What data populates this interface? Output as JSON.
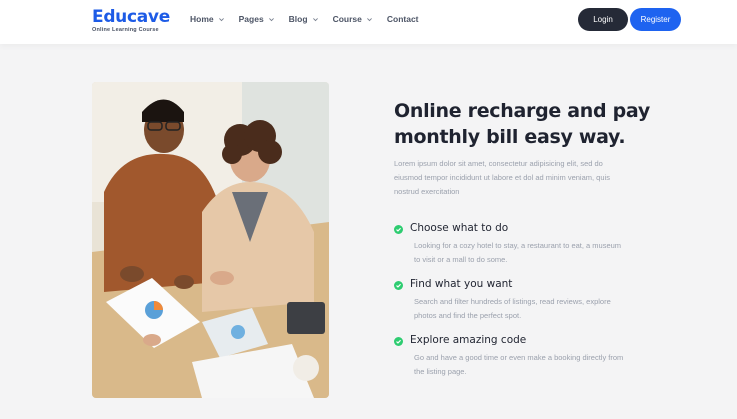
{
  "brand": {
    "name": "Educave",
    "tagline": "Online Learning Course",
    "color": "#1d5be6"
  },
  "nav": {
    "items": [
      {
        "label": "Home",
        "has_dropdown": true
      },
      {
        "label": "Pages",
        "has_dropdown": true
      },
      {
        "label": "Blog",
        "has_dropdown": true
      },
      {
        "label": "Course",
        "has_dropdown": true
      },
      {
        "label": "Contact",
        "has_dropdown": false
      }
    ],
    "login_label": "Login",
    "register_label": "Register"
  },
  "hero": {
    "image_alt": "people collaborating at a table",
    "headline": "Online recharge and pay monthly bill easy way.",
    "intro": "Lorem ipsum dolor sit amet, consectetur adipisicing elit, sed do eiusmod tempor incididunt ut labore et dol ad minim veniam, quis nostrud exercitation"
  },
  "features": [
    {
      "icon": "check-circle-icon",
      "title": "Choose what to do",
      "description": "Looking for a cozy hotel to stay, a restaurant to eat, a museum to visit or a mall to do some."
    },
    {
      "icon": "check-circle-icon",
      "title": "Find what you want",
      "description": "Search and filter hundreds of listings, read reviews, explore photos and find the perfect spot."
    },
    {
      "icon": "check-circle-icon",
      "title": "Explore amazing code",
      "description": "Go and have a good time or even make a booking directly from the listing page."
    }
  ],
  "colors": {
    "accent": "#1e63f0",
    "dark_button": "#252a37",
    "check": "#2ecc71"
  }
}
